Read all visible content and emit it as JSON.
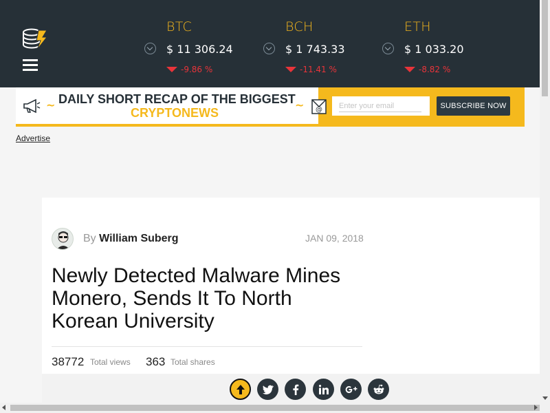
{
  "header": {
    "tickers": [
      {
        "symbol": "BTC",
        "price": "$ 11 306.24",
        "change": "-9.86 %"
      },
      {
        "symbol": "BCH",
        "price": "$ 1 743.33",
        "change": "-11.41 %"
      },
      {
        "symbol": "ETH",
        "price": "$ 1 033.20",
        "change": "-8.82 %"
      }
    ],
    "logo_icon": "coin-stack-lightning-icon",
    "menu_icon": "hamburger-icon"
  },
  "banner": {
    "line1": "DAILY SHORT RECAP OF THE BIGGEST",
    "line2": "CRYPTONEWS",
    "email_placeholder": "Enter your email",
    "subscribe_label": "SUBSCRIBE NOW"
  },
  "advertise_link": "Advertise",
  "article": {
    "by_prefix": "By",
    "author": "William Suberg",
    "date": "JAN 09, 2018",
    "title": "Newly Detected Malware Mines Monero, Sends It To North Korean University",
    "views_count": "38772",
    "views_label": "Total views",
    "shares_count": "363",
    "shares_label": "Total shares"
  },
  "share_bar": [
    "arrow-up-icon",
    "twitter-icon",
    "facebook-icon",
    "linkedin-icon",
    "google-plus-icon",
    "reddit-icon"
  ],
  "colors": {
    "header_bg": "#263037",
    "accent": "#f5b91d",
    "negative": "#e8343a",
    "share_button": "#2b353c"
  }
}
